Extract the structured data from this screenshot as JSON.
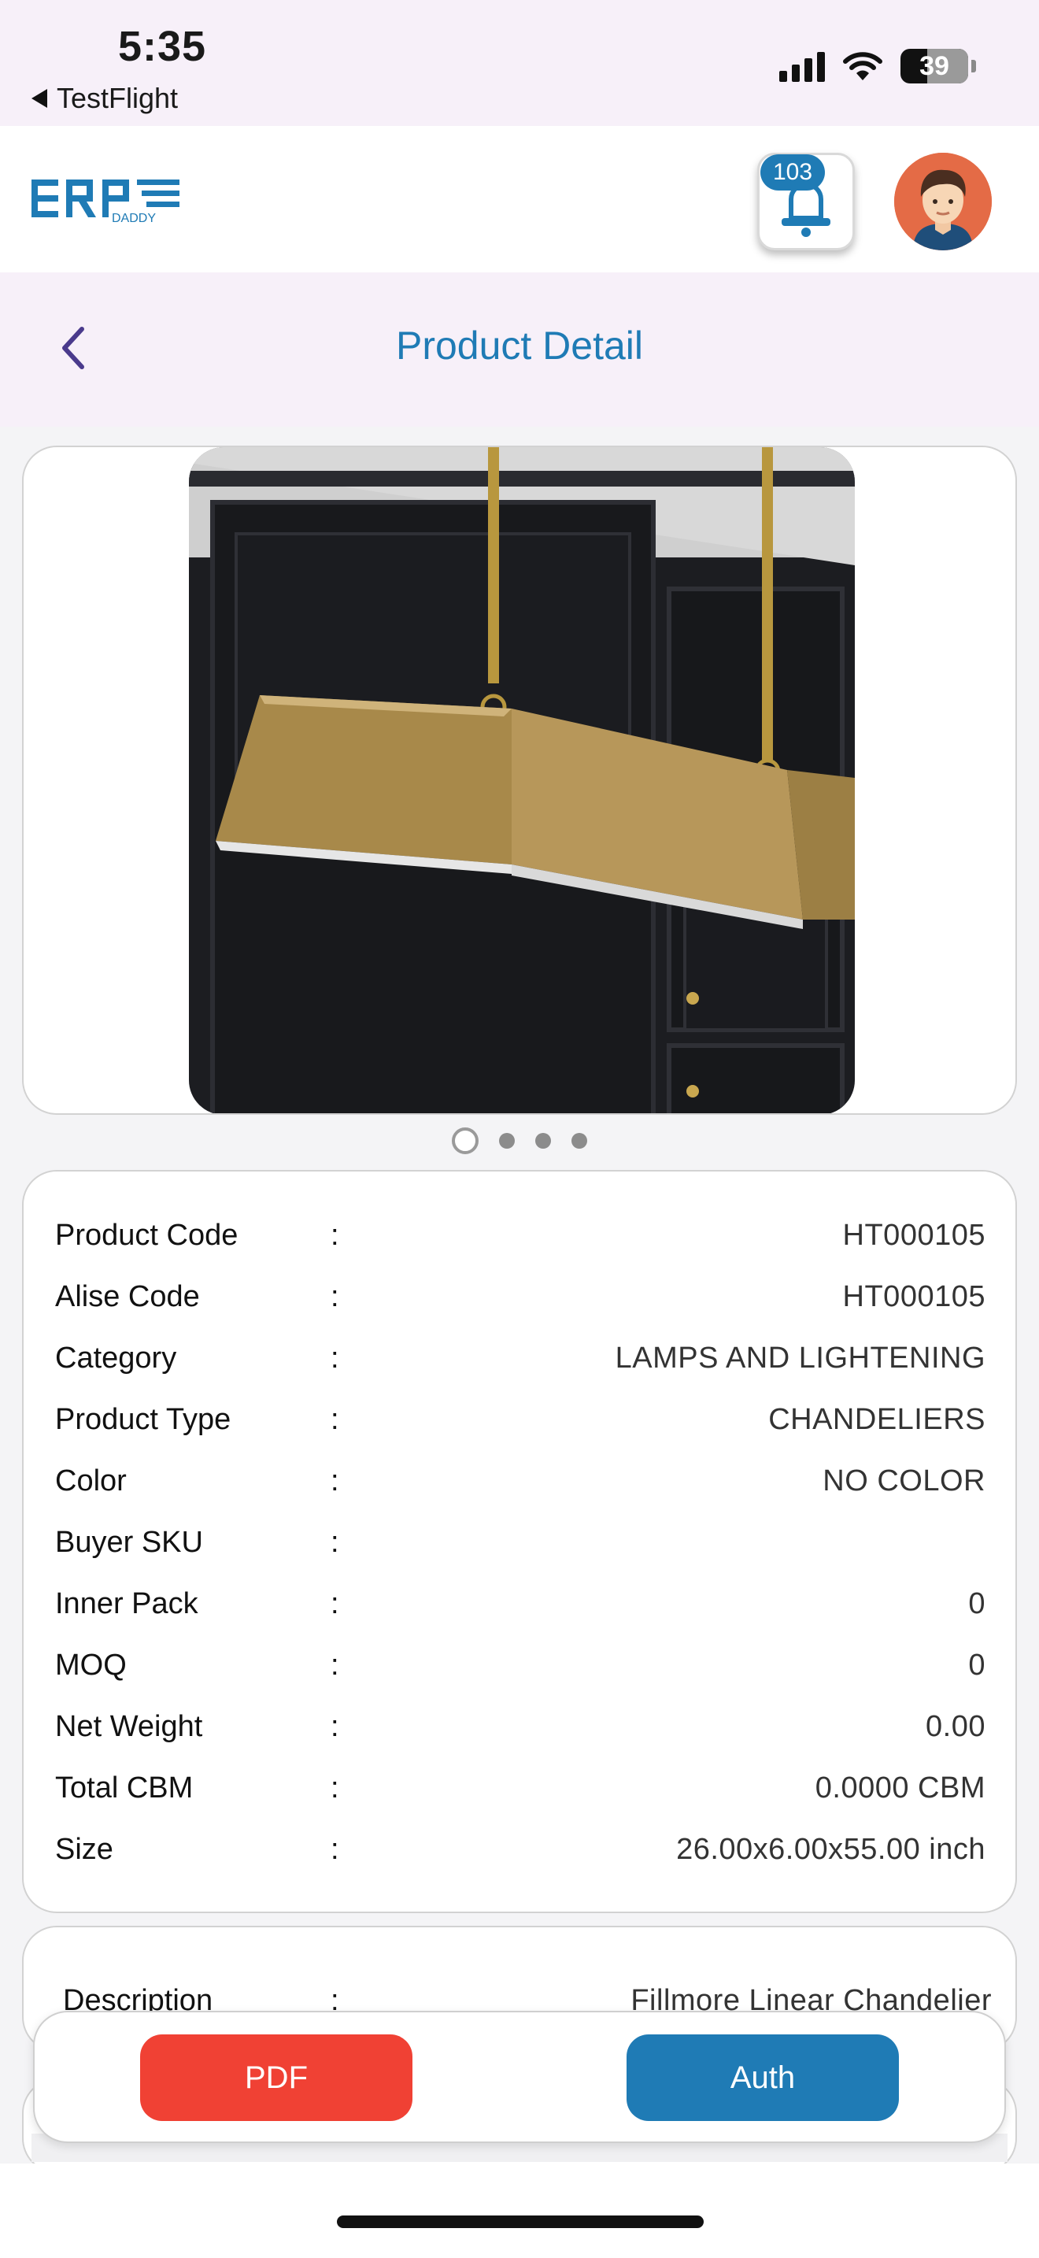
{
  "status_bar": {
    "time": "5:35",
    "back_app": "TestFlight",
    "battery": "39",
    "icons": [
      "cellular-signal-icon",
      "wifi-icon",
      "battery-icon"
    ]
  },
  "header": {
    "logo_text": "ERP",
    "logo_sub": "DADDY",
    "notification_count": "103",
    "icons": [
      "bell-icon",
      "avatar-icon"
    ],
    "accent_color": "#1f7bb5"
  },
  "title_bar": {
    "title": "Product Detail",
    "back_icon": "chevron-left-icon"
  },
  "carousel": {
    "image_subject": "brass linear chandelier",
    "slide_count": 4,
    "active_index": 0
  },
  "details": [
    {
      "label": "Product Code",
      "colon": ":",
      "value": "HT000105"
    },
    {
      "label": "Alise Code",
      "colon": ":",
      "value": "HT000105"
    },
    {
      "label": "Category",
      "colon": ":",
      "value": "LAMPS AND LIGHTENING"
    },
    {
      "label": "Product Type",
      "colon": ":",
      "value": "CHANDELIERS"
    },
    {
      "label": "Color",
      "colon": ":",
      "value": "NO COLOR"
    },
    {
      "label": "Buyer SKU",
      "colon": ":",
      "value": ""
    },
    {
      "label": "Inner Pack",
      "colon": ":",
      "value": "0"
    },
    {
      "label": "MOQ",
      "colon": ":",
      "value": "0"
    },
    {
      "label": "Net Weight",
      "colon": ":",
      "value": "0.00"
    },
    {
      "label": "Total CBM",
      "colon": ":",
      "value": "0.0000 CBM"
    },
    {
      "label": "Size",
      "colon": ":",
      "value": "26.00x6.00x55.00 inch"
    }
  ],
  "description": {
    "label": "Description",
    "colon": ":",
    "value": "Fillmore Linear Chandelier"
  },
  "actions": {
    "pdf_label": "PDF",
    "auth_label": "Auth",
    "pdf_color": "#f04134",
    "auth_color": "#1f7bb5"
  }
}
